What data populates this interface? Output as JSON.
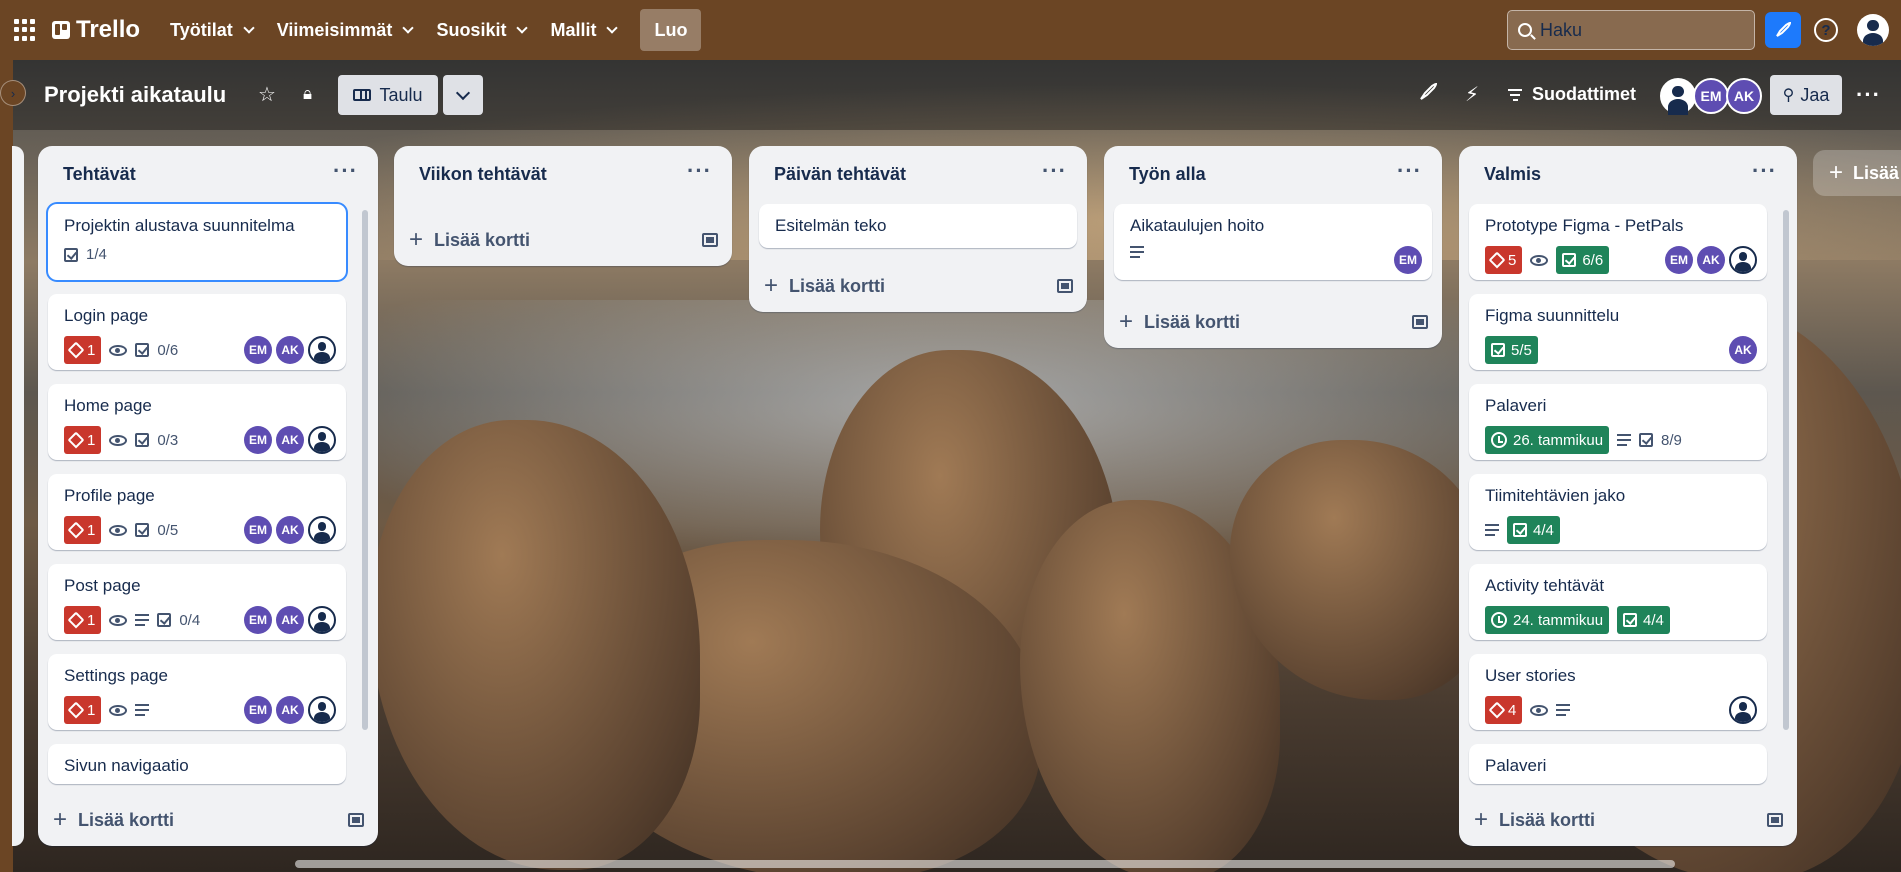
{
  "topbar": {
    "logo": "Trello",
    "nav": [
      "Työtilat",
      "Viimeisimmät",
      "Suosikit",
      "Mallit"
    ],
    "create": "Luo",
    "search_placeholder": "Haku"
  },
  "board": {
    "title": "Projekti aikataulu",
    "view": "Taulu",
    "filters": "Suodattimet",
    "members": [
      "EM",
      "AK"
    ],
    "share": "Jaa",
    "add_list": "Lisää"
  },
  "add_card": "Lisää kortti",
  "lists": [
    {
      "title": "Tehtävät",
      "cards": [
        {
          "title": "Projektin alustava suunnitelma",
          "checklist": "1/4"
        },
        {
          "title": "Login page",
          "votes": "1",
          "checklist": "0/6",
          "members": [
            "EM",
            "AK"
          ]
        },
        {
          "title": "Home page",
          "votes": "1",
          "checklist": "0/3",
          "members": [
            "EM",
            "AK"
          ]
        },
        {
          "title": "Profile page",
          "votes": "1",
          "checklist": "0/5",
          "members": [
            "EM",
            "AK"
          ]
        },
        {
          "title": "Post page",
          "votes": "1",
          "checklist": "0/4",
          "members": [
            "EM",
            "AK"
          ]
        },
        {
          "title": "Settings page",
          "votes": "1",
          "members": [
            "EM",
            "AK"
          ]
        },
        {
          "title": "Sivun navigaatio"
        }
      ]
    },
    {
      "title": "Viikon tehtävät",
      "cards": []
    },
    {
      "title": "Päivän tehtävät",
      "cards": [
        {
          "title": "Esitelmän teko"
        }
      ]
    },
    {
      "title": "Työn alla",
      "cards": [
        {
          "title": "Aikataulujen hoito",
          "members": [
            "EM"
          ]
        }
      ]
    },
    {
      "title": "Valmis",
      "cards": [
        {
          "title": "Prototype Figma - PetPals",
          "votes": "5",
          "checklist": "6/6",
          "members": [
            "EM",
            "AK"
          ]
        },
        {
          "title": "Figma suunnittelu",
          "checklist": "5/5",
          "members": [
            "AK"
          ]
        },
        {
          "title": "Palaveri",
          "due": "26. tammikuu",
          "checklist": "8/9"
        },
        {
          "title": "Tiimitehtävien jako",
          "checklist": "4/4"
        },
        {
          "title": "Activity tehtävät",
          "due": "24. tammikuu",
          "checklist": "4/4"
        },
        {
          "title": "User stories",
          "votes": "4"
        },
        {
          "title": "Palaveri"
        }
      ]
    }
  ],
  "colors": {
    "topbar": "#6b4524",
    "accent": "#1d7afc",
    "red": "#c9372c",
    "green": "#1f845a",
    "avatar": "#5e4db2"
  }
}
